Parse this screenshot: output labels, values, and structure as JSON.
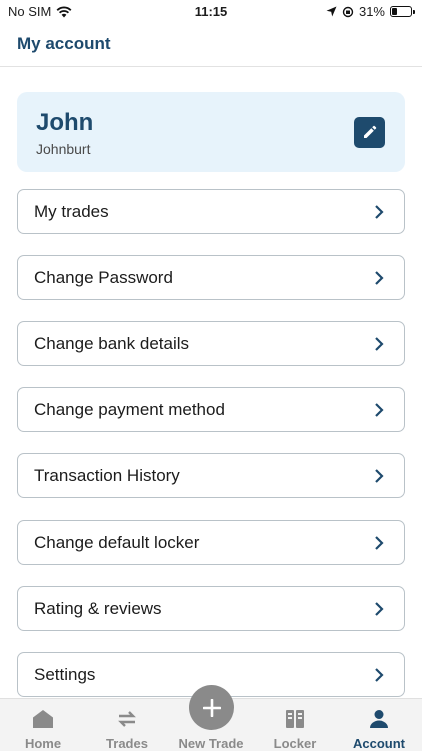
{
  "status_bar": {
    "carrier": "No SIM",
    "time": "11:15",
    "battery": "31%",
    "battery_level": 0.31
  },
  "header": {
    "title": "My account"
  },
  "profile": {
    "name": "John",
    "username": "Johnburt"
  },
  "menu": [
    {
      "label": "My trades"
    },
    {
      "label": "Change Password"
    },
    {
      "label": "Change bank details"
    },
    {
      "label": "Change payment method"
    },
    {
      "label": "Transaction History"
    },
    {
      "label": "Change default locker"
    },
    {
      "label": "Rating & reviews"
    },
    {
      "label": "Settings"
    }
  ],
  "tab_bar": {
    "items": [
      {
        "label": "Home",
        "icon": "home-icon",
        "active": false
      },
      {
        "label": "Trades",
        "icon": "trades-icon",
        "active": false
      },
      {
        "label": "New Trade",
        "icon": "plus-icon",
        "active": false
      },
      {
        "label": "Locker",
        "icon": "locker-icon",
        "active": false
      },
      {
        "label": "Account",
        "icon": "account-icon",
        "active": true
      }
    ]
  },
  "colors": {
    "brand": "#1e4a6d",
    "card_bg": "#e7f3fb",
    "inactive": "#8a8a8a"
  }
}
